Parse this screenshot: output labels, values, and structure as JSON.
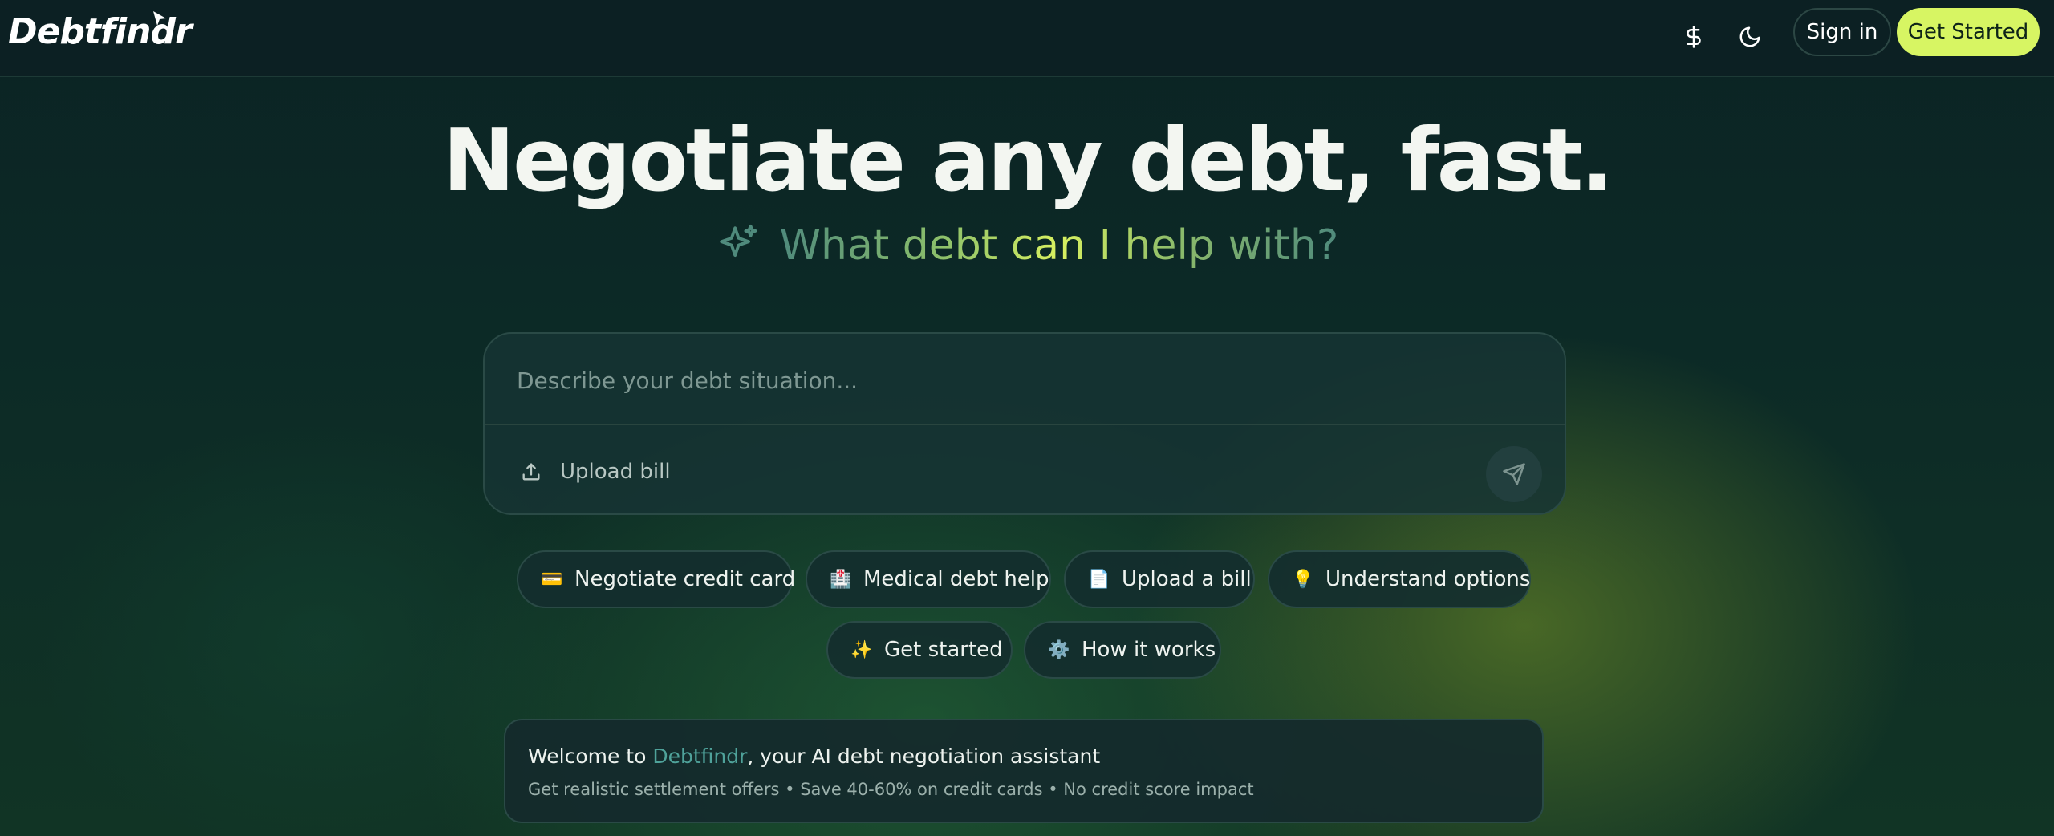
{
  "header": {
    "logo": "Debtfindr",
    "currency_icon": "dollar-icon",
    "theme_icon": "moon-icon",
    "sign_in_label": "Sign in",
    "get_started_label": "Get Started"
  },
  "hero": {
    "title": "Negotiate any debt, fast.",
    "subtitle": "What debt can I help with?",
    "subtitle_icon": "sparkle-icon"
  },
  "composer": {
    "placeholder": "Describe your debt situation...",
    "upload_label": "Upload bill",
    "upload_icon": "upload-icon",
    "send_icon": "send-icon"
  },
  "suggestions": [
    {
      "emoji": "💳",
      "label": "Negotiate credit card"
    },
    {
      "emoji": "🏥",
      "label": "Medical debt help"
    },
    {
      "emoji": "📄",
      "label": "Upload a bill"
    },
    {
      "emoji": "💡",
      "label": "Understand options"
    },
    {
      "emoji": "✨",
      "label": "Get started"
    },
    {
      "emoji": "⚙️",
      "label": "How it works"
    }
  ],
  "welcome": {
    "prefix": "Welcome to ",
    "brand": "Debtfindr",
    "suffix": ", your AI debt negotiation assistant",
    "details": "Get realistic settlement offers • Save 40-60% on credit cards • No credit score impact"
  },
  "colors": {
    "accent": "#d7f563",
    "brand_teal": "#4fa29a",
    "background": "#0c2023"
  }
}
